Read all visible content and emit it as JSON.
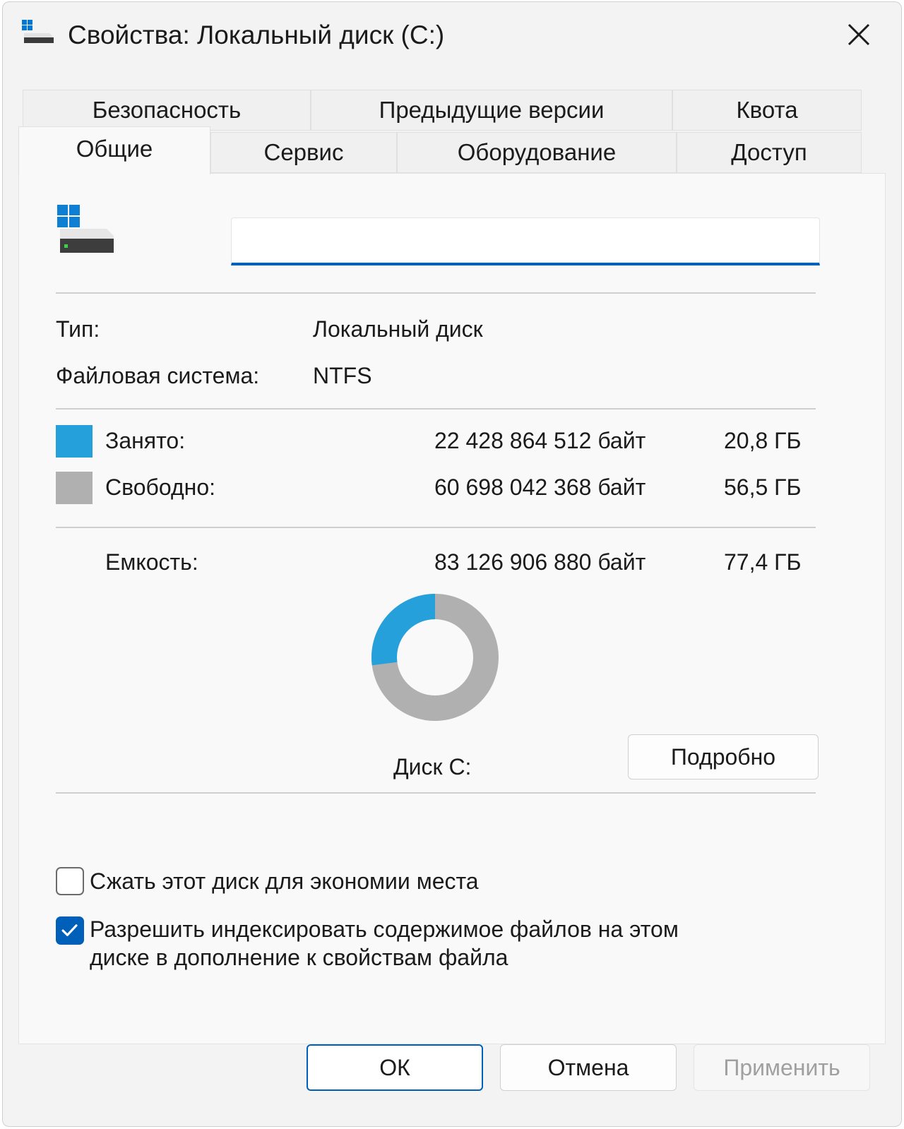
{
  "window": {
    "title": "Свойства: Локальный диск (C:)"
  },
  "tabs_row1": [
    {
      "label": "Безопасность"
    },
    {
      "label": "Предыдущие версии"
    },
    {
      "label": "Квота"
    }
  ],
  "tabs_row2": [
    {
      "label": "Общие",
      "active": true
    },
    {
      "label": "Сервис"
    },
    {
      "label": "Оборудование"
    },
    {
      "label": "Доступ"
    }
  ],
  "general": {
    "name_value": "",
    "type_label": "Тип:",
    "type_value": "Локальный диск",
    "fs_label": "Файловая система:",
    "fs_value": "NTFS",
    "used_label": "Занято:",
    "used_bytes": "22 428 864 512 байт",
    "used_size": "20,8 ГБ",
    "free_label": "Свободно:",
    "free_bytes": "60 698 042 368 байт",
    "free_size": "56,5 ГБ",
    "capacity_label": "Емкость:",
    "capacity_bytes": "83 126 906 880 байт",
    "capacity_size": "77,4 ГБ",
    "disk_label": "Диск C:",
    "details_button": "Подробно",
    "compress_label": "Сжать этот диск для экономии места",
    "compress_checked": false,
    "index_label_line1": "Разрешить индексировать содержимое файлов на этом",
    "index_label_line2": "диске в дополнение к свойствам файла",
    "index_checked": true
  },
  "usage": {
    "used_fraction": 0.27,
    "used_color": "#26a0da",
    "free_color": "#b0b0b0"
  },
  "buttons": {
    "ok": "ОК",
    "cancel": "Отмена",
    "apply": "Применить"
  },
  "icons": {
    "title": "drive-icon",
    "close": "close-icon",
    "drive": "windows-drive-icon",
    "check": "checkmark-icon"
  }
}
